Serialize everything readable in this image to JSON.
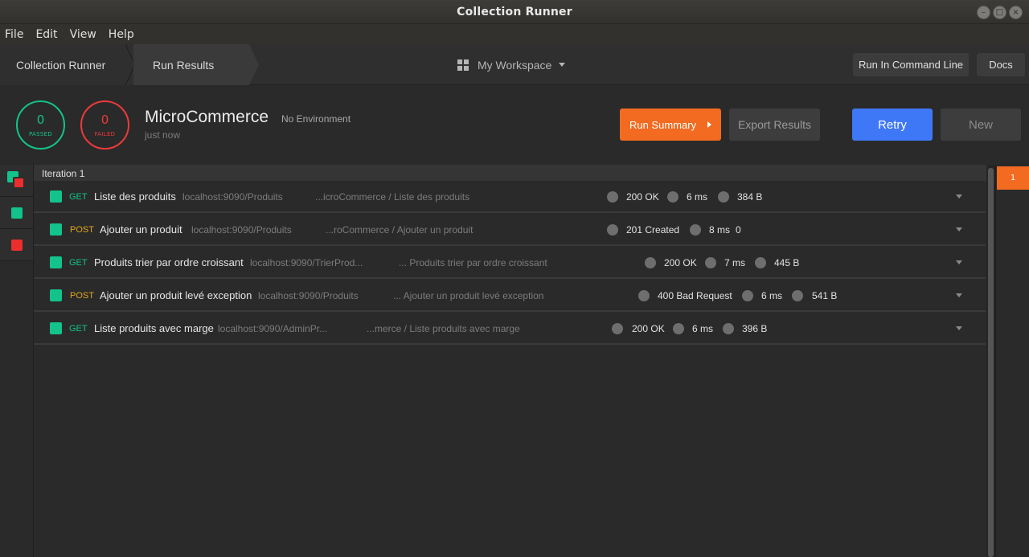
{
  "window": {
    "title": "Collection Runner"
  },
  "menu": [
    "File",
    "Edit",
    "View",
    "Help"
  ],
  "nav": {
    "crumbs": [
      "Collection Runner",
      "Run Results"
    ],
    "workspace": "My Workspace",
    "cli_button": "Run In Command Line",
    "docs_button": "Docs"
  },
  "summary": {
    "passed_count": "0",
    "passed_label": "PASSED",
    "failed_count": "0",
    "failed_label": "FAILED",
    "collection": "MicroCommerce",
    "environment": "No Environment",
    "time": "just now",
    "run_summary_button": "Run Summary",
    "export_button": "Export Results",
    "retry_button": "Retry",
    "new_button": "New"
  },
  "iteration": {
    "label": "Iteration 1",
    "selector": "1"
  },
  "requests": [
    {
      "status_color": "green",
      "method": "GET",
      "name": "Liste des produits",
      "url": "localhost:9090/Produits",
      "path": "...icroCommerce / Liste des produits",
      "code": "200 OK",
      "time": "6 ms",
      "size": "384 B"
    },
    {
      "status_color": "green",
      "method": "POST",
      "name": "Ajouter un produit",
      "url": "localhost:9090/Produits",
      "path": "...roCommerce / Ajouter un produit",
      "code": "201 Created",
      "time": "8 ms",
      "size": "0"
    },
    {
      "status_color": "green",
      "method": "GET",
      "name": "Produits trier par ordre croissant",
      "url": "localhost:9090/TrierProd...",
      "path": "... Produits trier par ordre croissant",
      "code": "200 OK",
      "time": "7 ms",
      "size": "445 B"
    },
    {
      "status_color": "green",
      "method": "POST",
      "name": "Ajouter un produit levé exception",
      "url": "localhost:9090/Produits",
      "path": "... Ajouter un produit levé exception",
      "code": "400 Bad Request",
      "time": "6 ms",
      "size": "541 B"
    },
    {
      "status_color": "green",
      "method": "GET",
      "name": "Liste produits avec marge",
      "url": "localhost:9090/AdminPr...",
      "path": "...merce / Liste produits avec marge",
      "code": "200 OK",
      "time": "6 ms",
      "size": "396 B"
    }
  ],
  "colors": {
    "accent": "#f26b21",
    "pass": "#13c38b",
    "fail": "#ed3a3a",
    "primary": "#3f78f6",
    "get": "#13c38b",
    "post": "#e3a71d"
  }
}
